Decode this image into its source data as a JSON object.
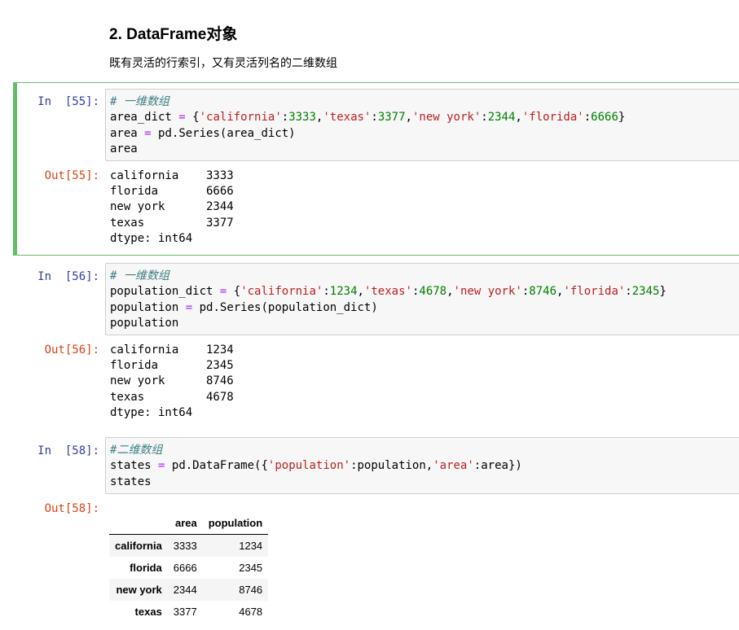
{
  "markdown": {
    "heading": "2. DataFrame对象",
    "text": "既有灵活的行索引，又有灵活列名的二维数组"
  },
  "cells": [
    {
      "in_prompt": "In  [55]:",
      "out_prompt": "Out[55]:",
      "code": {
        "comment": "# 一维数组",
        "line2": {
          "var": "area_dict",
          "eq": "=",
          "open": "{",
          "k1": "'california'",
          "v1": "3333",
          "k2": "'texas'",
          "v2": "3377",
          "k3": "'new york'",
          "v3": "2344",
          "k4": "'florida'",
          "v4": "6666",
          "close": "}"
        },
        "line3": {
          "var": "area",
          "eq": "=",
          "rhs": "pd.Series(area_dict)"
        },
        "line4": "area"
      },
      "output": [
        "california    3333",
        "florida       6666",
        "new york      2344",
        "texas         3377",
        "dtype: int64"
      ]
    },
    {
      "in_prompt": "In  [56]:",
      "out_prompt": "Out[56]:",
      "code": {
        "comment": "# 一维数组",
        "line2": {
          "var": "population_dict",
          "eq": "=",
          "open": "{",
          "k1": "'california'",
          "v1": "1234",
          "k2": "'texas'",
          "v2": "4678",
          "k3": "'new york'",
          "v3": "8746",
          "k4": "'florida'",
          "v4": "2345",
          "close": "}"
        },
        "line3": {
          "var": "population",
          "eq": "=",
          "rhs": "pd.Series(population_dict)"
        },
        "line4": "population"
      },
      "output": [
        "california    1234",
        "florida       2345",
        "new york      8746",
        "texas         4678",
        "dtype: int64"
      ]
    },
    {
      "in_prompt": "In  [58]:",
      "out_prompt": "Out[58]:",
      "code": {
        "comment": "#二维数组",
        "line2": {
          "var": "states",
          "eq": "=",
          "call": "pd.DataFrame({",
          "k1": "'population'",
          "v1": "population,",
          "k2": "'area'",
          "v2": "area})"
        },
        "line3": "states"
      },
      "table": {
        "columns": [
          "area",
          "population"
        ],
        "rows": [
          {
            "index": "california",
            "area": "3333",
            "population": "1234"
          },
          {
            "index": "florida",
            "area": "6666",
            "population": "2345"
          },
          {
            "index": "new york",
            "area": "2344",
            "population": "8746"
          },
          {
            "index": "texas",
            "area": "3377",
            "population": "4678"
          }
        ]
      }
    }
  ],
  "colors": {
    "selected_border": "#66bb6a",
    "in_prompt": "#303f9f",
    "out_prompt": "#d84315",
    "comment": "#408080",
    "string": "#ba2121",
    "number": "#008000",
    "operator": "#aa22ff"
  }
}
